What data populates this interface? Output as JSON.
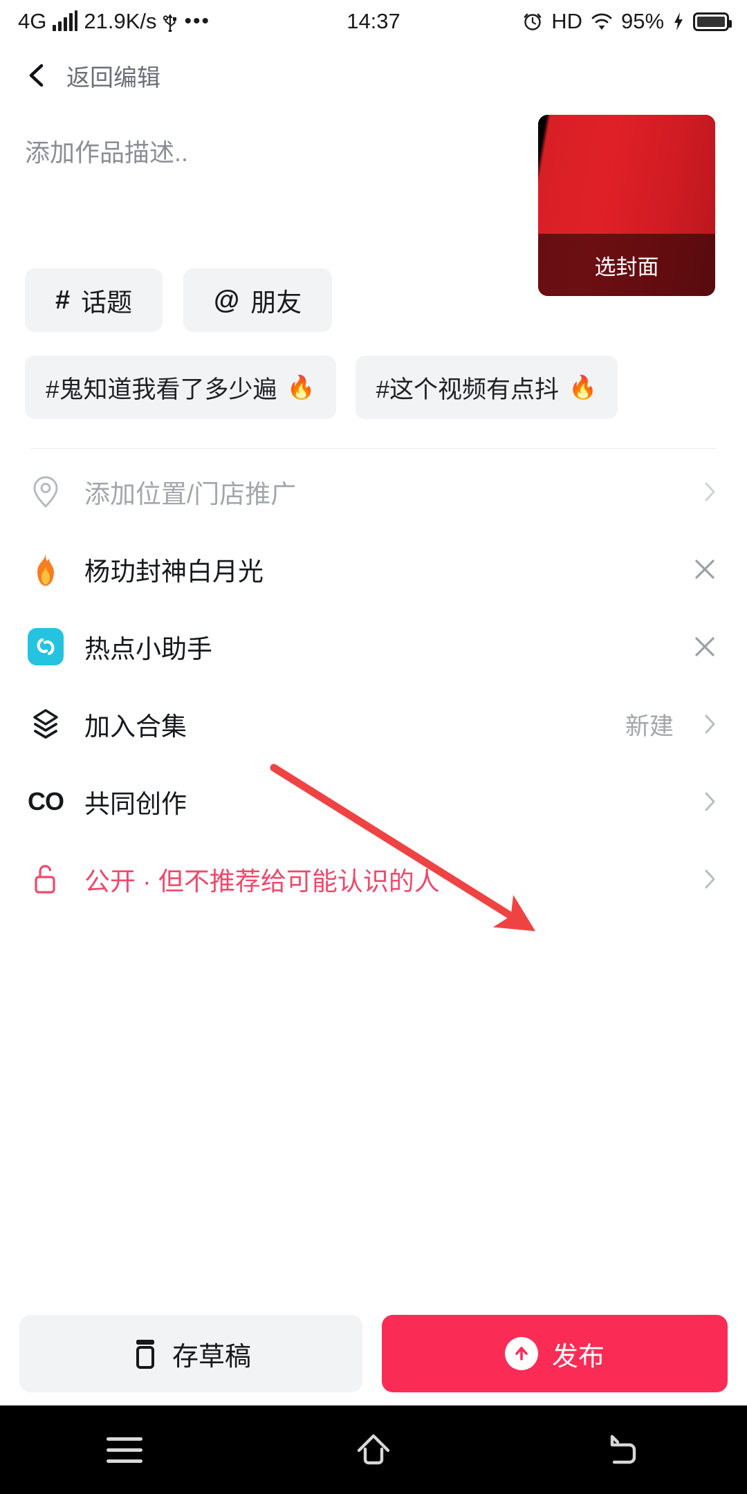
{
  "status_bar": {
    "network_type": "4G",
    "data_rate": "21.9K/s",
    "usb_icon": "usb-icon",
    "more_icon": "more-dots-icon",
    "time": "14:37",
    "alarm_icon": "alarm-icon",
    "hd_label": "HD",
    "wifi_icon": "wifi-icon",
    "battery_percent": "95%",
    "charging_icon": "charging-bolt-icon"
  },
  "top_nav": {
    "back_icon": "back-chevron-icon",
    "back_label": "返回编辑"
  },
  "description": {
    "placeholder": "添加作品描述.."
  },
  "cover": {
    "select_cover_label": "选封面"
  },
  "chips": [
    {
      "symbol": "#",
      "label": "话题",
      "name": "topic"
    },
    {
      "symbol": "@",
      "label": "朋友",
      "name": "friend"
    }
  ],
  "suggested_tags": [
    {
      "text": "#鬼知道我看了多少遍",
      "flame": "🔥"
    },
    {
      "text": "#这个视频有点抖",
      "flame": "🔥"
    }
  ],
  "options": [
    {
      "icon": "location-pin-icon",
      "label": "添加位置/门店推广",
      "style": "muted",
      "trailing": "chevron",
      "right_text": ""
    },
    {
      "icon": "flame-icon",
      "label": "杨玏封神白月光",
      "style": "normal",
      "trailing": "close",
      "right_text": ""
    },
    {
      "icon": "hotspot-assistant-icon",
      "label": "热点小助手",
      "style": "normal",
      "trailing": "close",
      "right_text": ""
    },
    {
      "icon": "layers-icon",
      "label": "加入合集",
      "style": "normal",
      "trailing": "chevron",
      "right_text": "新建"
    },
    {
      "icon": "co-create-icon",
      "label": "共同创作",
      "style": "normal",
      "trailing": "chevron",
      "right_text": ""
    },
    {
      "icon": "unlock-icon",
      "label": "公开 · 但不推荐给可能认识的人",
      "style": "pink",
      "trailing": "chevron",
      "right_text": ""
    }
  ],
  "actions": {
    "draft_icon": "draft-box-icon",
    "draft_label": "存草稿",
    "publish_icon": "upload-arrow-icon",
    "publish_label": "发布"
  },
  "nav_bar": {
    "menu_icon": "menu-icon",
    "home_icon": "home-icon",
    "back_icon": "back-return-icon"
  },
  "annotation": {
    "type": "arrow",
    "color": "#ef4343",
    "points_to": "publish-button"
  },
  "colors": {
    "accent_pink": "#fa2c55",
    "privacy_pink": "#f1486b",
    "chip_bg": "#f2f3f5",
    "muted_text": "#a3a6ab",
    "hotspot_cyan": "#24c3e0",
    "annotation_red": "#ef4343"
  }
}
